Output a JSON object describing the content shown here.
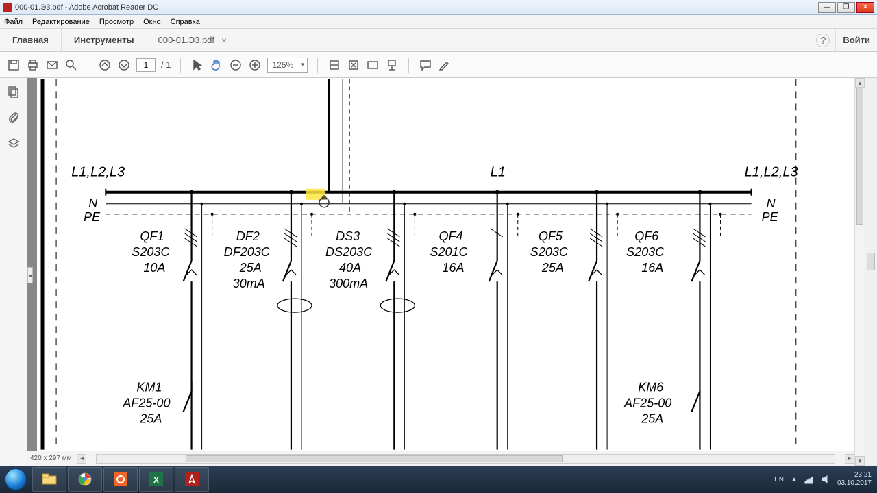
{
  "window": {
    "title": "000-01.Э3.pdf - Adobe Acrobat Reader DC"
  },
  "menu": {
    "file": "Файл",
    "edit": "Редактирование",
    "view": "Просмотр",
    "window": "Окно",
    "help": "Справка"
  },
  "tabs": {
    "home": "Главная",
    "tools": "Инструменты",
    "doc": "000-01.Э3.pdf",
    "signin": "Войти"
  },
  "toolbar": {
    "page": "1",
    "pages": "/ 1",
    "zoom": "125%"
  },
  "statusbar": {
    "size": "420 x 297 мм"
  },
  "diagram": {
    "left_label": "L1,L2,L3",
    "right_label": "L1,L2,L3",
    "mid_label": "L1",
    "n": "N",
    "pe": "PE",
    "breakers": [
      {
        "l1": "QF1",
        "l2": "S203C",
        "l3": "10A",
        "l4": ""
      },
      {
        "l1": "DF2",
        "l2": "DF203C",
        "l3": "25A",
        "l4": "30mA"
      },
      {
        "l1": "DS3",
        "l2": "DS203C",
        "l3": "40A",
        "l4": "300mA"
      },
      {
        "l1": "QF4",
        "l2": "S201C",
        "l3": "16A",
        "l4": ""
      },
      {
        "l1": "QF5",
        "l2": "S203C",
        "l3": "25A",
        "l4": ""
      },
      {
        "l1": "QF6",
        "l2": "S203C",
        "l3": "16A",
        "l4": ""
      }
    ],
    "km": [
      {
        "l1": "KM1",
        "l2": "AF25-00",
        "l3": "25A"
      },
      {
        "l1": "KM6",
        "l2": "AF25-00",
        "l3": "25A"
      }
    ]
  },
  "tray": {
    "lang": "EN",
    "time": "23:21",
    "date": "03.10.2017"
  }
}
